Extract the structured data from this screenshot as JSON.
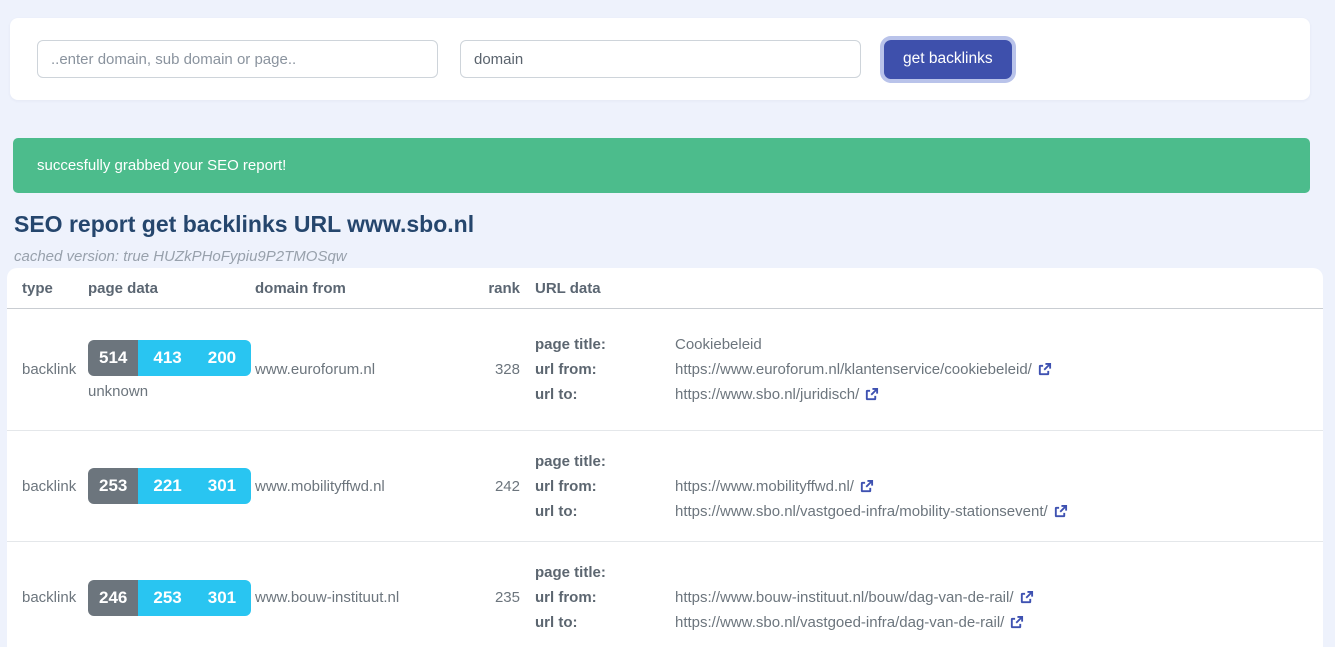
{
  "search": {
    "query_placeholder": "..enter domain, sub domain or page..",
    "type_value": "domain",
    "button_label": "get backlinks"
  },
  "alert": {
    "message": "succesfully grabbed your SEO report!"
  },
  "report": {
    "title": "SEO report get backlinks URL www.sbo.nl",
    "cached_note": "cached version: true HUZkPHoFypiu9P2TMOSqw"
  },
  "table": {
    "headers": [
      "type",
      "page data",
      "domain from",
      "rank",
      "URL data"
    ],
    "url_labels": {
      "page_title": "page title:",
      "url_from": "url from:",
      "url_to": "url to:"
    },
    "rows": [
      {
        "type": "backlink",
        "metric1": "514",
        "metric2": "413",
        "metric3": "200",
        "page_data_note": "unknown",
        "domain_from": "www.euroforum.nl",
        "rank": "328",
        "page_title": "Cookiebeleid",
        "url_from": "https://www.euroforum.nl/klantenservice/cookiebeleid/",
        "url_to": "https://www.sbo.nl/juridisch/"
      },
      {
        "type": "backlink",
        "metric1": "253",
        "metric2": "221",
        "metric3": "301",
        "page_data_note": "",
        "domain_from": "www.mobilityffwd.nl",
        "rank": "242",
        "page_title": "",
        "url_from": "https://www.mobilityffwd.nl/",
        "url_to": "https://www.sbo.nl/vastgoed-infra/mobility-stationsevent/"
      },
      {
        "type": "backlink",
        "metric1": "246",
        "metric2": "253",
        "metric3": "301",
        "page_data_note": "",
        "domain_from": "www.bouw-instituut.nl",
        "rank": "235",
        "page_title": "",
        "url_from": "https://www.bouw-instituut.nl/bouw/dag-van-de-rail/",
        "url_to": "https://www.sbo.nl/vastgoed-infra/dag-van-de-rail/"
      }
    ]
  },
  "colors": {
    "page_background": "#eef2fc",
    "accent_indigo": "#3e50ac",
    "focus_ring": "#b9c3ea",
    "success_green": "#4cbc8c",
    "info_cyan": "#29c5f1",
    "secondary_gray": "#6c757d",
    "heading_navy": "#25466d",
    "link_icon_blue": "#3e51b1"
  }
}
